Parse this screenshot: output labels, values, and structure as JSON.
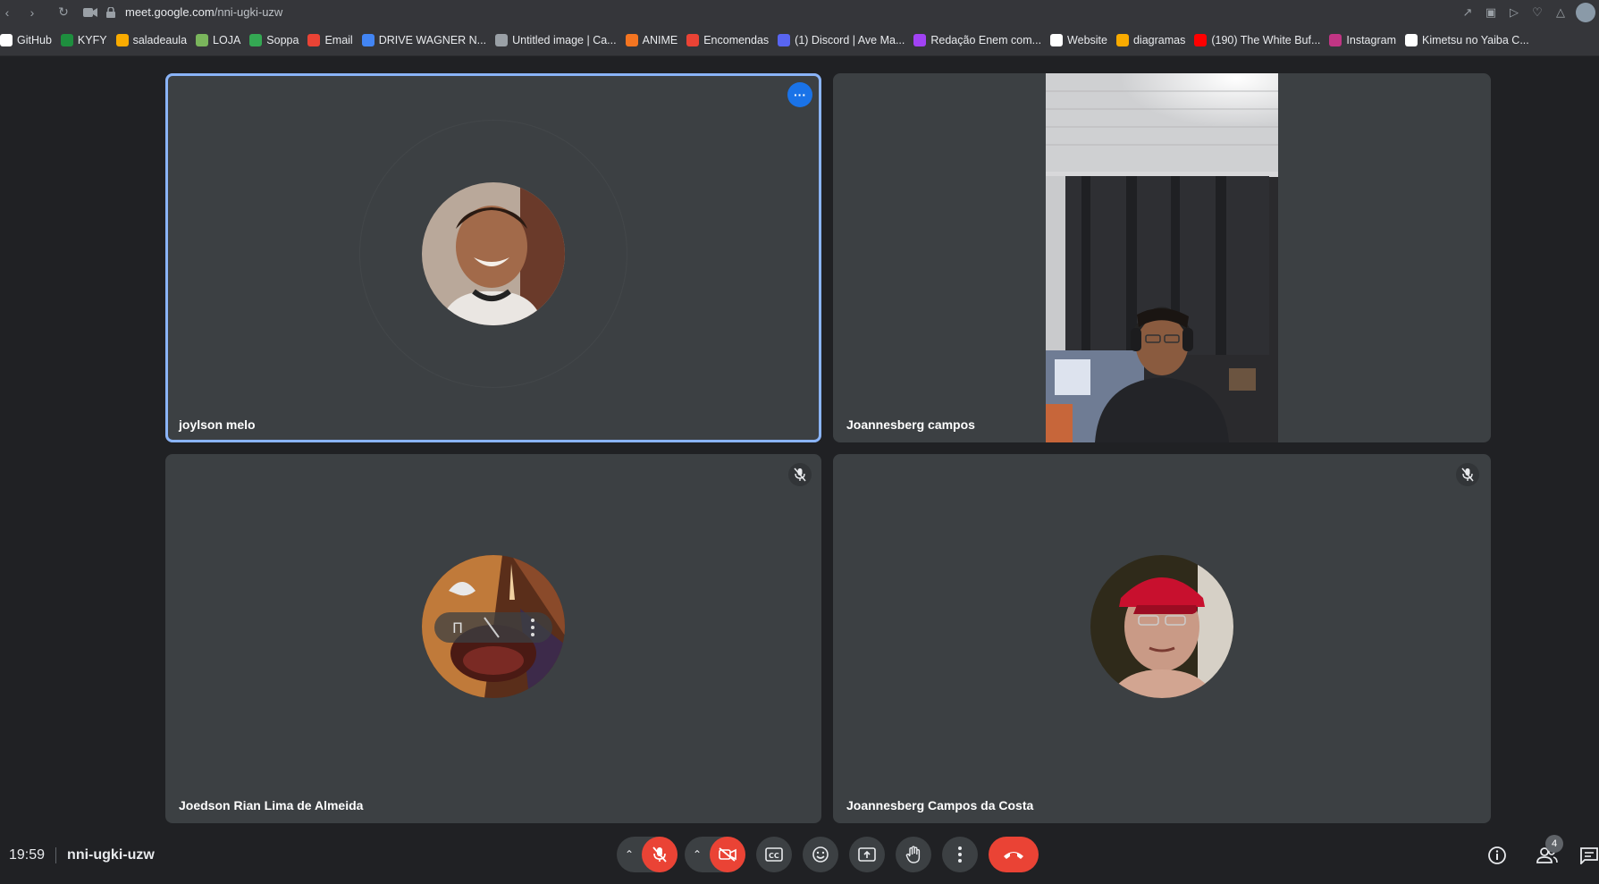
{
  "browser": {
    "url_host": "meet.google.com",
    "url_path": "/nni-ugki-uzw",
    "bookmarks": [
      {
        "label": "GitHub",
        "icon": "github-icon",
        "color": "#ffffff"
      },
      {
        "label": "KYFY",
        "icon": "kyfy-icon",
        "color": "#1e8e3e"
      },
      {
        "label": "saladeaula",
        "icon": "saladeaula-icon",
        "color": "#f9ab00"
      },
      {
        "label": "LOJA",
        "icon": "shopify-icon",
        "color": "#7ab55c"
      },
      {
        "label": "Soppa",
        "icon": "soppa-icon",
        "color": "#34a853"
      },
      {
        "label": "Email",
        "icon": "gmail-icon",
        "color": "#ea4335"
      },
      {
        "label": "DRIVE WAGNER N...",
        "icon": "drive-icon",
        "color": "#4285f4"
      },
      {
        "label": "Untitled image | Ca...",
        "icon": "canva-icon",
        "color": "#9aa0a6"
      },
      {
        "label": "ANIME",
        "icon": "crunchyroll-icon",
        "color": "#f47521"
      },
      {
        "label": "Encomendas",
        "icon": "encomendas-icon",
        "color": "#ea4335"
      },
      {
        "label": "(1) Discord | Ave Ma...",
        "icon": "discord-icon",
        "color": "#5865f2"
      },
      {
        "label": "Redação Enem com...",
        "icon": "redacao-icon",
        "color": "#a142f4"
      },
      {
        "label": "Website",
        "icon": "document-icon",
        "color": "#ffffff"
      },
      {
        "label": "diagramas",
        "icon": "diagramas-icon",
        "color": "#f9ab00"
      },
      {
        "label": "(190) The White Buf...",
        "icon": "youtube-icon",
        "color": "#ff0000"
      },
      {
        "label": "Instagram",
        "icon": "instagram-icon",
        "color": "#c13584"
      },
      {
        "label": "Kimetsu no Yaiba C...",
        "icon": "medium-icon",
        "color": "#ffffff"
      }
    ]
  },
  "participants": [
    {
      "name": "joylson melo",
      "active": true,
      "muted": false
    },
    {
      "name": "Joannesberg campos",
      "active": false,
      "muted": false,
      "video": true
    },
    {
      "name": "Joedson Rian Lima de Almeida",
      "active": false,
      "muted": true
    },
    {
      "name": "Joannesberg Campos da Costa",
      "active": false,
      "muted": true
    }
  ],
  "footer": {
    "time": "19:59",
    "meeting_code": "nni-ugki-uzw",
    "participants_count": "4"
  },
  "colors": {
    "accent": "#8ab4f8",
    "danger": "#ea4335",
    "tile_bg": "#3c4043",
    "page_bg": "#202124"
  }
}
